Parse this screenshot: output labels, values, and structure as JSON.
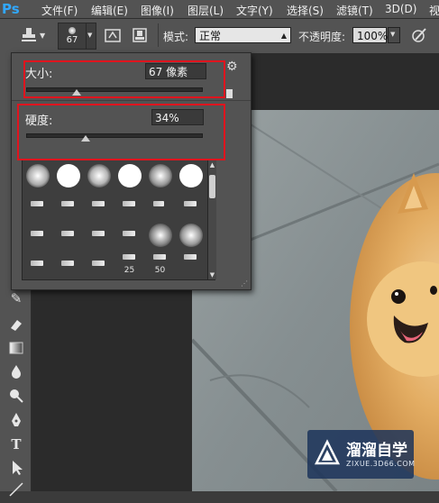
{
  "app": {
    "logo": "Ps"
  },
  "menu": [
    "文件(F)",
    "编辑(E)",
    "图像(I)",
    "图层(L)",
    "文字(Y)",
    "选择(S)",
    "滤镜(T)",
    "3D(D)",
    "视"
  ],
  "options": {
    "brush_size_preview": "67",
    "mode_label": "模式:",
    "mode_value": "正常",
    "opacity_label": "不透明度:",
    "opacity_value": "100%"
  },
  "brush_panel": {
    "size_label": "大小:",
    "size_value": "67 像素",
    "size_level": 0.29,
    "hardness_label": "硬度:",
    "hardness_value": "34%",
    "hardness_level": 0.34,
    "preset_labels": [
      "25",
      "50"
    ]
  },
  "watermark": {
    "title": "溜溜自学",
    "url": "ZIXUE.3D66.COM"
  },
  "colors": {
    "ui_bg": "#535353",
    "highlight": "#e0141e",
    "ps_blue": "#31a8ff"
  }
}
